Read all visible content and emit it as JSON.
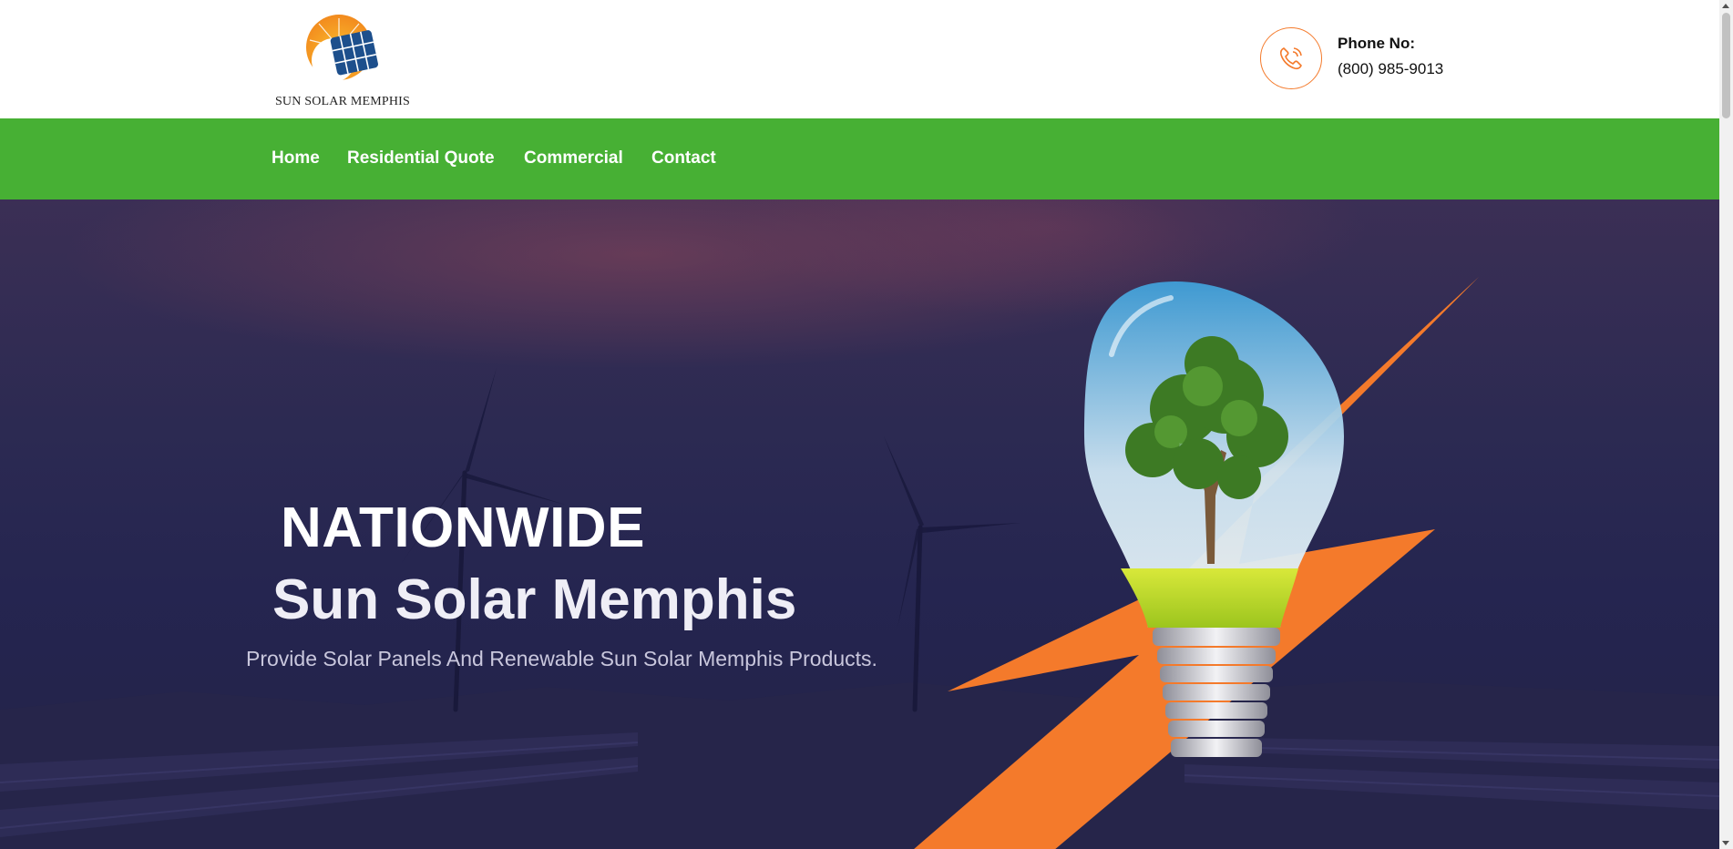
{
  "header": {
    "logo_text": "SUN SOLAR MEMPHIS",
    "phone_label": "Phone No:",
    "phone_number": "(800) 985-9013",
    "icons": {
      "logo": "sun-solar-panel-logo",
      "phone": "phone-icon"
    }
  },
  "nav": {
    "items": [
      {
        "label": "Home"
      },
      {
        "label": "Residential Quote"
      },
      {
        "label": "Commercial"
      },
      {
        "label": "Contact"
      }
    ]
  },
  "hero": {
    "title_line1": "NATIONWIDE",
    "title_line2": "Sun Solar Memphis",
    "subtitle": "Provide Solar Panels And Renewable Sun Solar Memphis Products."
  },
  "colors": {
    "nav_green": "#47b034",
    "accent_orange": "#f47a2b",
    "hero_dark": "#252550",
    "logo_blue": "#1d4f8c"
  }
}
